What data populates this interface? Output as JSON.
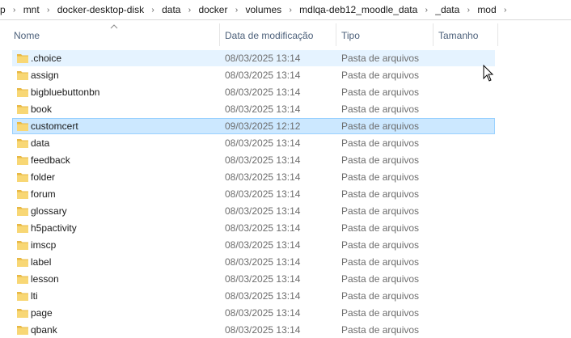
{
  "breadcrumb": [
    "p",
    "mnt",
    "docker-desktop-disk",
    "data",
    "docker",
    "volumes",
    "mdlqa-deb12_moodle_data",
    "_data",
    "mod"
  ],
  "columns": {
    "name": "Nome",
    "date": "Data de modificação",
    "type": "Tipo",
    "size": "Tamanho"
  },
  "rows": [
    {
      "name": ".choice",
      "date": "08/03/2025 13:14",
      "type": "Pasta de arquivos"
    },
    {
      "name": "assign",
      "date": "08/03/2025 13:14",
      "type": "Pasta de arquivos"
    },
    {
      "name": "bigbluebuttonbn",
      "date": "08/03/2025 13:14",
      "type": "Pasta de arquivos"
    },
    {
      "name": "book",
      "date": "08/03/2025 13:14",
      "type": "Pasta de arquivos"
    },
    {
      "name": "customcert",
      "date": "09/03/2025 12:12",
      "type": "Pasta de arquivos"
    },
    {
      "name": "data",
      "date": "08/03/2025 13:14",
      "type": "Pasta de arquivos"
    },
    {
      "name": "feedback",
      "date": "08/03/2025 13:14",
      "type": "Pasta de arquivos"
    },
    {
      "name": "folder",
      "date": "08/03/2025 13:14",
      "type": "Pasta de arquivos"
    },
    {
      "name": "forum",
      "date": "08/03/2025 13:14",
      "type": "Pasta de arquivos"
    },
    {
      "name": "glossary",
      "date": "08/03/2025 13:14",
      "type": "Pasta de arquivos"
    },
    {
      "name": "h5pactivity",
      "date": "08/03/2025 13:14",
      "type": "Pasta de arquivos"
    },
    {
      "name": "imscp",
      "date": "08/03/2025 13:14",
      "type": "Pasta de arquivos"
    },
    {
      "name": "label",
      "date": "08/03/2025 13:14",
      "type": "Pasta de arquivos"
    },
    {
      "name": "lesson",
      "date": "08/03/2025 13:14",
      "type": "Pasta de arquivos"
    },
    {
      "name": "lti",
      "date": "08/03/2025 13:14",
      "type": "Pasta de arquivos"
    },
    {
      "name": "page",
      "date": "08/03/2025 13:14",
      "type": "Pasta de arquivos"
    },
    {
      "name": "qbank",
      "date": "08/03/2025 13:14",
      "type": "Pasta de arquivos"
    }
  ],
  "hover_row": 0,
  "selected_row": 4,
  "colors": {
    "hover_bg": "#e5f3ff",
    "selected_bg": "#cce8ff",
    "selected_border": "#99d1ff",
    "header_text": "#4c607a",
    "folder_yellow": "#f8d775"
  },
  "icons": {
    "row": "folder-icon",
    "sort": "sort-up-icon",
    "separator": "chevron-right-icon",
    "cursor": "mouse-pointer-icon"
  }
}
